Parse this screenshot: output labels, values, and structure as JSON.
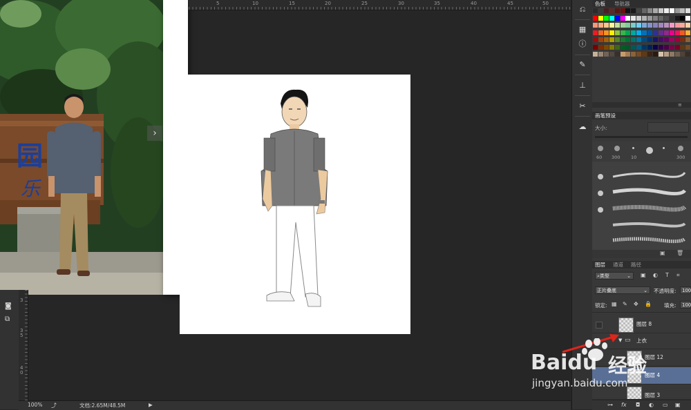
{
  "ruler": {
    "top_labels": [
      "5",
      "10",
      "15",
      "20",
      "25",
      "30",
      "35",
      "40",
      "45",
      "50"
    ],
    "left_labels": [
      "3",
      "3\n5",
      "4\n0"
    ]
  },
  "statusbar": {
    "zoom": "100%",
    "doc_info": "文档:2.65M/48.5M",
    "arrow": "▶"
  },
  "reference_photo": {
    "sign_text_1": "园",
    "sign_text_2": "乐",
    "nav_arrow": "›"
  },
  "icon_strip": {
    "icons": [
      "history-icon",
      "color-icon",
      "info-icon",
      "brush-icon",
      "stamp-icon",
      "tools-icon",
      "cloud-icon"
    ]
  },
  "swatches_panel": {
    "tabs": [
      "色板",
      "导航器"
    ]
  },
  "brush_panel": {
    "tab": "画笔预设",
    "size_label": "大小:",
    "sizes": [
      "60",
      "300",
      "10",
      "",
      "",
      "300"
    ]
  },
  "layers_panel": {
    "tabs": [
      "图层",
      "通道",
      "路径"
    ],
    "filter_kind": "类型",
    "blend_mode": "正片叠底",
    "opacity_label": "不透明度:",
    "opacity_value": "100",
    "lock_label": "锁定:",
    "fill_label": "填充:",
    "fill_value": "100",
    "layers": [
      {
        "name": "图层 8"
      },
      {
        "name": "上衣",
        "group": true
      },
      {
        "name": "图层 12"
      },
      {
        "name": "图层 4",
        "selected": true
      },
      {
        "name": "图层 3"
      }
    ],
    "footer": [
      "link-icon",
      "fx",
      "mask-icon",
      "adjustment-icon",
      "folder-icon",
      "new-layer-icon",
      "trash-icon"
    ]
  },
  "watermark": {
    "brand": "Baidu",
    "brand_cn": "经验",
    "url": "jingyan.baidu.com"
  }
}
